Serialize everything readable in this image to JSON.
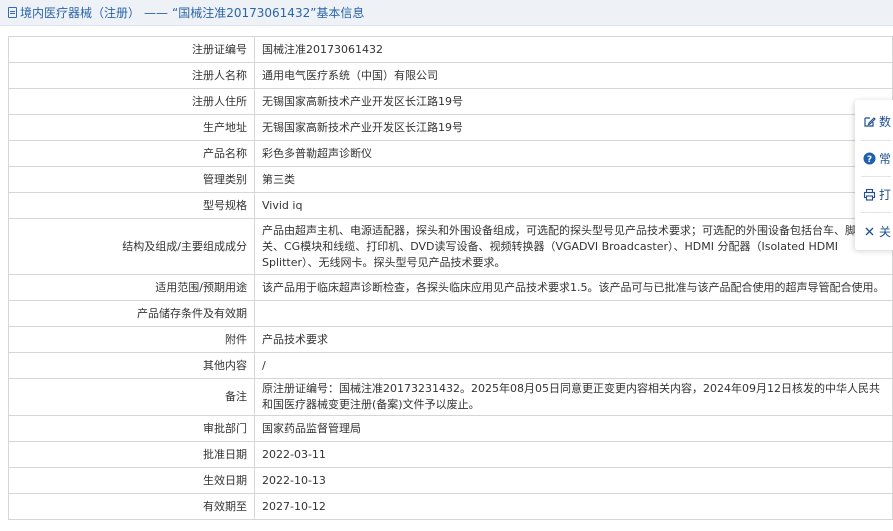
{
  "header": {
    "crumb": "境内医疗器械（注册）",
    "separator": "——",
    "title": "“国械注准20173061432”基本信息"
  },
  "rows": [
    {
      "label": "注册证编号",
      "value": "国械注准20173061432"
    },
    {
      "label": "注册人名称",
      "value": "通用电气医疗系统（中国）有限公司"
    },
    {
      "label": "注册人住所",
      "value": "无锡国家高新技术产业开发区长江路19号"
    },
    {
      "label": "生产地址",
      "value": "无锡国家高新技术产业开发区长江路19号"
    },
    {
      "label": "产品名称",
      "value": "彩色多普勒超声诊断仪"
    },
    {
      "label": "管理类别",
      "value": "第三类"
    },
    {
      "label": "型号规格",
      "value": "Vivid iq"
    },
    {
      "label": "结构及组成/主要组成成分",
      "value": "产品由超声主机、电源适配器，探头和外围设备组成，可选配的探头型号见产品技术要求；可选配的外围设备包括台车、脚踏开关、CG模块和线缆、打印机、DVD读写设备、视频转换器（VGADVI Broadcaster）、HDMI 分配器（Isolated HDMI Splitter）、无线网卡。探头型号见产品技术要求。"
    },
    {
      "label": "适用范围/预期用途",
      "value": "该产品用于临床超声诊断检查，各探头临床应用见产品技术要求1.5。该产品可与已批准与该产品配合使用的超声导管配合使用。"
    },
    {
      "label": "产品储存条件及有效期",
      "value": ""
    },
    {
      "label": "附件",
      "value": "产品技术要求"
    },
    {
      "label": "其他内容",
      "value": "/"
    },
    {
      "label": "备注",
      "value": "原注册证编号：国械注准20173231432。2025年08月05日同意更正变更内容相关内容，2024年09月12日核发的中华人民共和国医疗器械变更注册(备案)文件予以废止。"
    },
    {
      "label": "审批部门",
      "value": "国家药品监督管理局"
    },
    {
      "label": "批准日期",
      "value": "2022-03-11"
    },
    {
      "label": "生效日期",
      "value": "2022-10-13"
    },
    {
      "label": "有效期至",
      "value": "2027-10-12"
    }
  ],
  "float_panel": {
    "items": [
      {
        "icon": "edit-icon",
        "label": "数"
      },
      {
        "icon": "help-icon",
        "label": "常"
      },
      {
        "icon": "print-icon",
        "label": "打"
      },
      {
        "icon": "close-icon",
        "label": "关"
      }
    ]
  },
  "colors": {
    "link": "#2b64a8",
    "header_bg": "#eef2f7",
    "border": "#d6d6d6",
    "help_icon": "#1f5fb0"
  }
}
